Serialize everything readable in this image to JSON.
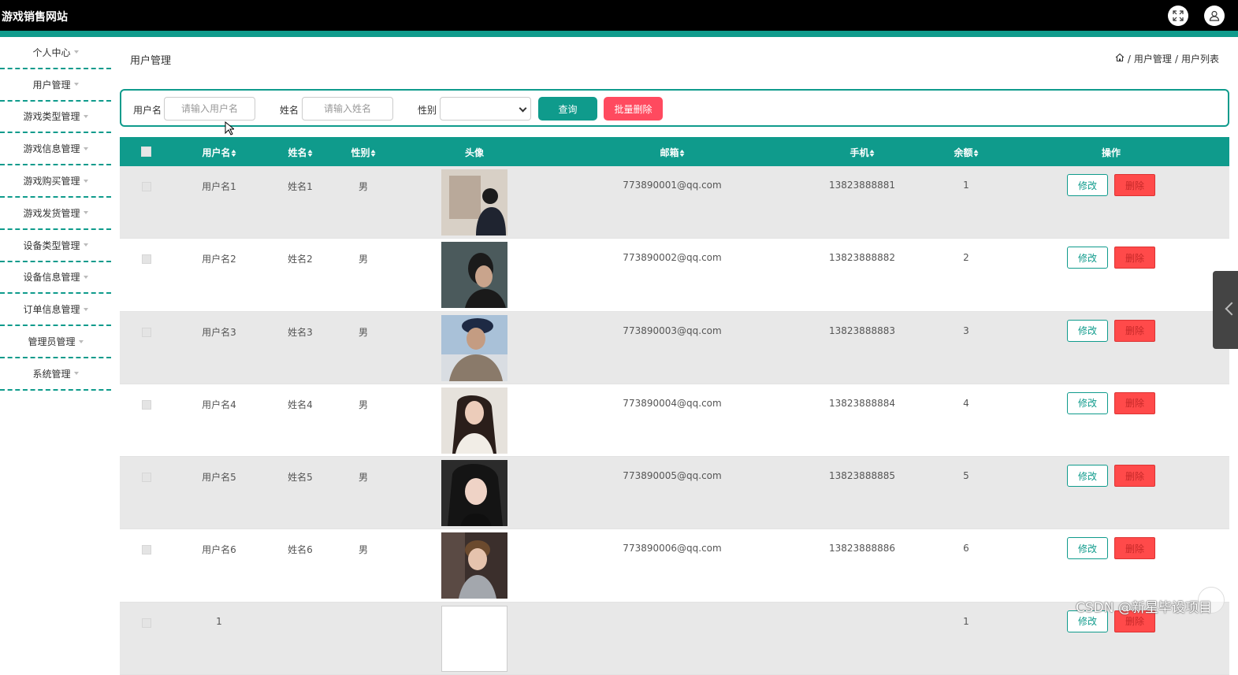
{
  "app": {
    "title": "游戏销售网站"
  },
  "header_icons": [
    "fullscreen-icon",
    "user-icon"
  ],
  "sidebar": {
    "items": [
      {
        "label": "个人中心"
      },
      {
        "label": "用户管理"
      },
      {
        "label": "游戏类型管理"
      },
      {
        "label": "游戏信息管理"
      },
      {
        "label": "游戏购买管理"
      },
      {
        "label": "游戏发货管理"
      },
      {
        "label": "设备类型管理"
      },
      {
        "label": "设备信息管理"
      },
      {
        "label": "订单信息管理"
      },
      {
        "label": "管理员管理"
      },
      {
        "label": "系统管理"
      }
    ]
  },
  "page": {
    "title": "用户管理",
    "breadcrumb": [
      "用户管理",
      "用户列表"
    ],
    "breadcrumb_sep": "/"
  },
  "search": {
    "username_label": "用户名",
    "username_placeholder": "请输入用户名",
    "name_label": "姓名",
    "name_placeholder": "请输入姓名",
    "gender_label": "性别",
    "gender_value": "",
    "query_label": "查询",
    "batch_delete_label": "批量删除"
  },
  "table": {
    "headers": {
      "username": "用户名",
      "name": "姓名",
      "gender": "性别",
      "avatar": "头像",
      "email": "邮箱",
      "phone": "手机",
      "balance": "余额",
      "actions": "操作"
    },
    "edit_label": "修改",
    "delete_label": "删除",
    "rows": [
      {
        "username": "用户名1",
        "name": "姓名1",
        "gender": "男",
        "email": "773890001@qq.com",
        "phone": "13823888881",
        "balance": "1"
      },
      {
        "username": "用户名2",
        "name": "姓名2",
        "gender": "男",
        "email": "773890002@qq.com",
        "phone": "13823888882",
        "balance": "2"
      },
      {
        "username": "用户名3",
        "name": "姓名3",
        "gender": "男",
        "email": "773890003@qq.com",
        "phone": "13823888883",
        "balance": "3"
      },
      {
        "username": "用户名4",
        "name": "姓名4",
        "gender": "男",
        "email": "773890004@qq.com",
        "phone": "13823888884",
        "balance": "4"
      },
      {
        "username": "用户名5",
        "name": "姓名5",
        "gender": "男",
        "email": "773890005@qq.com",
        "phone": "13823888885",
        "balance": "5"
      },
      {
        "username": "用户名6",
        "name": "姓名6",
        "gender": "男",
        "email": "773890006@qq.com",
        "phone": "13823888886",
        "balance": "6"
      }
    ],
    "partial_row": {
      "username": "1",
      "balance": "1"
    }
  },
  "watermark": "CSDN @新星毕设项目",
  "colors": {
    "accent": "#0f9b8c",
    "danger": "#ff4a4a",
    "topbar": "#000000"
  }
}
